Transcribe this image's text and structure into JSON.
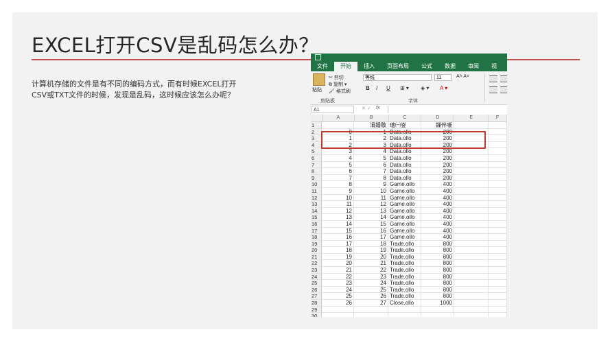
{
  "slide": {
    "title": "EXCEL打开CSV是乱码怎么办？",
    "body_lines": [
      "计算机存储的文件是有不同的编码方式，而有时候EXCEL打开",
      "CSV或TXT文件的时候，发现是乱码，这时候应该怎么办呢？"
    ],
    "accent_color": "#c0504d"
  },
  "excel": {
    "tabs": [
      "文件",
      "开始",
      "插入",
      "页面布局",
      "公式",
      "数据",
      "审阅",
      "视"
    ],
    "active_tab": "开始",
    "clipboard": {
      "paste": "粘贴",
      "cut": "剪切",
      "copy": "复制",
      "format_painter": "格式刷",
      "group_label": "剪贴板"
    },
    "font": {
      "name": "等线",
      "size": "11",
      "grow": "A˄ A˅",
      "bold": "B",
      "italic": "I",
      "underline": "U",
      "group_label": "字体"
    },
    "name_box": "A1",
    "fx": "fx",
    "columns": [
      "A",
      "B",
      "C",
      "D",
      "E",
      "F"
    ],
    "rows": [
      {
        "n": "1",
        "a": "",
        "b": "涓婚敭",
        "c": "璁㈠崟",
        "d": "鏁伴噺"
      },
      {
        "n": "2",
        "a": "0",
        "b": "1",
        "c": "Data.ollo",
        "d": "200"
      },
      {
        "n": "3",
        "a": "1",
        "b": "2",
        "c": "Data.ollo",
        "d": "200"
      },
      {
        "n": "4",
        "a": "2",
        "b": "3",
        "c": "Data.ollo",
        "d": "200"
      },
      {
        "n": "5",
        "a": "3",
        "b": "4",
        "c": "Data.ollo",
        "d": "200"
      },
      {
        "n": "6",
        "a": "4",
        "b": "5",
        "c": "Data.ollo",
        "d": "200"
      },
      {
        "n": "7",
        "a": "5",
        "b": "6",
        "c": "Data.ollo",
        "d": "200"
      },
      {
        "n": "8",
        "a": "6",
        "b": "7",
        "c": "Data.ollo",
        "d": "200"
      },
      {
        "n": "9",
        "a": "7",
        "b": "8",
        "c": "Data.ollo",
        "d": "200"
      },
      {
        "n": "10",
        "a": "8",
        "b": "9",
        "c": "Game.ollo",
        "d": "400"
      },
      {
        "n": "11",
        "a": "9",
        "b": "10",
        "c": "Game.ollo",
        "d": "400"
      },
      {
        "n": "12",
        "a": "10",
        "b": "11",
        "c": "Game.ollo",
        "d": "400"
      },
      {
        "n": "13",
        "a": "11",
        "b": "12",
        "c": "Game.ollo",
        "d": "400"
      },
      {
        "n": "14",
        "a": "12",
        "b": "13",
        "c": "Game.ollo",
        "d": "400"
      },
      {
        "n": "15",
        "a": "13",
        "b": "14",
        "c": "Game.ollo",
        "d": "400"
      },
      {
        "n": "16",
        "a": "14",
        "b": "15",
        "c": "Game.ollo",
        "d": "400"
      },
      {
        "n": "17",
        "a": "15",
        "b": "16",
        "c": "Game.ollo",
        "d": "400"
      },
      {
        "n": "18",
        "a": "16",
        "b": "17",
        "c": "Game.ollo",
        "d": "400"
      },
      {
        "n": "19",
        "a": "17",
        "b": "18",
        "c": "Trade.ollo",
        "d": "800"
      },
      {
        "n": "20",
        "a": "18",
        "b": "19",
        "c": "Trade.ollo",
        "d": "800"
      },
      {
        "n": "21",
        "a": "19",
        "b": "20",
        "c": "Trade.ollo",
        "d": "800"
      },
      {
        "n": "22",
        "a": "20",
        "b": "21",
        "c": "Trade.ollo",
        "d": "800"
      },
      {
        "n": "23",
        "a": "21",
        "b": "22",
        "c": "Trade.ollo",
        "d": "800"
      },
      {
        "n": "24",
        "a": "22",
        "b": "23",
        "c": "Trade.ollo",
        "d": "800"
      },
      {
        "n": "25",
        "a": "23",
        "b": "24",
        "c": "Trade.ollo",
        "d": "800"
      },
      {
        "n": "26",
        "a": "24",
        "b": "25",
        "c": "Trade.ollo",
        "d": "800"
      },
      {
        "n": "27",
        "a": "25",
        "b": "26",
        "c": "Trade.ollo",
        "d": "800"
      },
      {
        "n": "28",
        "a": "26",
        "b": "27",
        "c": "Close.ollo",
        "d": "1000"
      },
      {
        "n": "29",
        "a": "",
        "b": "",
        "c": "",
        "d": ""
      },
      {
        "n": "30",
        "a": "",
        "b": "",
        "c": "",
        "d": ""
      }
    ],
    "highlight_color": "#c0392b"
  }
}
